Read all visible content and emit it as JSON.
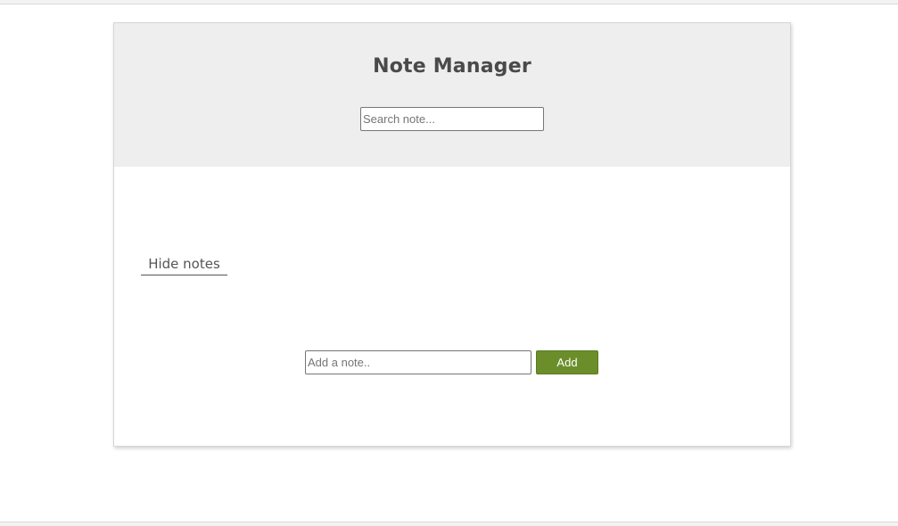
{
  "header": {
    "title": "Note Manager",
    "search": {
      "placeholder": "Search note...",
      "value": ""
    }
  },
  "notes_toggle": {
    "label": "Hide notes"
  },
  "add_form": {
    "input_placeholder": "Add a note..",
    "input_value": "",
    "button_label": "Add"
  },
  "colors": {
    "header_bg": "#eeeeee",
    "title_text": "#4a4a4a",
    "add_button_bg": "#6b8e2b",
    "add_button_text": "#ffffff"
  }
}
